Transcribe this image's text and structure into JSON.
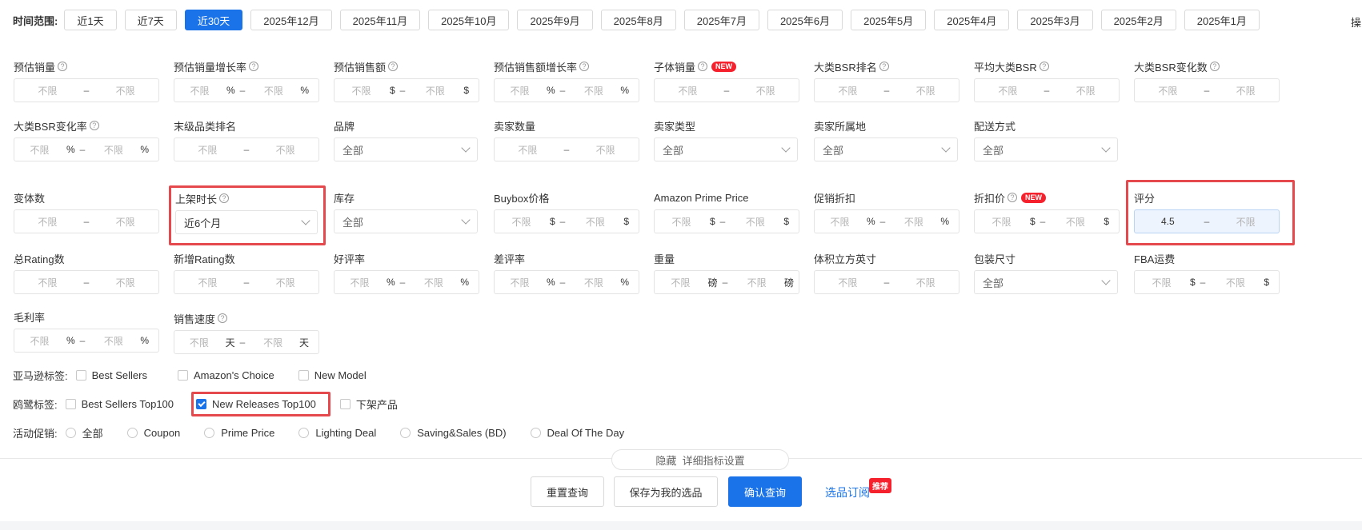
{
  "time_range": {
    "label": "时间范围:",
    "options": [
      "近1天",
      "近7天",
      "近30天",
      "2025年12月",
      "2025年11月",
      "2025年10月",
      "2025年9月",
      "2025年8月",
      "2025年7月",
      "2025年6月",
      "2025年5月",
      "2025年4月",
      "2025年3月",
      "2025年2月",
      "2025年1月"
    ],
    "active": "近30天",
    "trailing": "操"
  },
  "placeholder": "不限",
  "filters": {
    "est_sales": {
      "label": "预估销量"
    },
    "est_sales_growth": {
      "label": "预估销量增长率",
      "unit": "%"
    },
    "est_revenue": {
      "label": "预估销售额",
      "unit": "$"
    },
    "est_revenue_growth": {
      "label": "预估销售额增长率",
      "unit": "%"
    },
    "child_sales": {
      "label": "子体销量",
      "badge": "NEW"
    },
    "bsr_rank": {
      "label": "大类BSR排名"
    },
    "avg_bsr": {
      "label": "平均大类BSR"
    },
    "bsr_change": {
      "label": "大类BSR变化数"
    },
    "bsr_change_rate": {
      "label": "大类BSR变化率",
      "unit": "%"
    },
    "leaf_rank": {
      "label": "末级品类排名"
    },
    "brand": {
      "label": "品牌",
      "value": "全部"
    },
    "seller_count": {
      "label": "卖家数量"
    },
    "seller_type": {
      "label": "卖家类型",
      "value": "全部"
    },
    "seller_location": {
      "label": "卖家所属地",
      "value": "全部"
    },
    "fulfillment": {
      "label": "配送方式",
      "value": "全部"
    },
    "variants": {
      "label": "变体数"
    },
    "listing_age": {
      "label": "上架时长",
      "value": "近6个月"
    },
    "inventory": {
      "label": "库存",
      "value": "全部"
    },
    "buybox_price": {
      "label": "Buybox价格",
      "unit": "$"
    },
    "prime_price": {
      "label": "Amazon Prime Price",
      "unit": "$"
    },
    "promo_discount": {
      "label": "促销折扣",
      "unit": "%"
    },
    "discount_price": {
      "label": "折扣价",
      "unit": "$",
      "badge": "NEW"
    },
    "rating": {
      "label": "评分",
      "min": "4.5"
    },
    "total_rating": {
      "label": "总Rating数"
    },
    "new_rating": {
      "label": "新增Rating数"
    },
    "positive_rate": {
      "label": "好评率",
      "unit": "%"
    },
    "negative_rate": {
      "label": "差评率",
      "unit": "%"
    },
    "weight": {
      "label": "重量",
      "unit": "磅"
    },
    "volume": {
      "label": "体积立方英寸"
    },
    "package_size": {
      "label": "包装尺寸",
      "value": "全部"
    },
    "fba_fee": {
      "label": "FBA运费",
      "unit": "$"
    },
    "gross_margin": {
      "label": "毛利率",
      "unit": "%"
    },
    "sales_velocity": {
      "label": "销售速度",
      "unit": "天"
    }
  },
  "amazon_tags": {
    "label": "亚马逊标签:",
    "options": [
      "Best Sellers",
      "Amazon's Choice",
      "New Model"
    ]
  },
  "sellersprite_tags": {
    "label": "鸥鹭标签:",
    "options": [
      "Best Sellers Top100",
      "New Releases Top100",
      "下架产品"
    ],
    "checked": "New Releases Top100"
  },
  "promotions": {
    "label": "活动促销:",
    "options": [
      "全部",
      "Coupon",
      "Prime Price",
      "Lighting Deal",
      "Saving&Sales (BD)",
      "Deal Of The Day"
    ]
  },
  "toggle": {
    "hide": "隐藏",
    "detail": "详细指标设置"
  },
  "actions": {
    "reset": "重置查询",
    "save": "保存为我的选品",
    "confirm": "确认查询",
    "subscribe": "选品订阅",
    "badge": "推荐"
  }
}
